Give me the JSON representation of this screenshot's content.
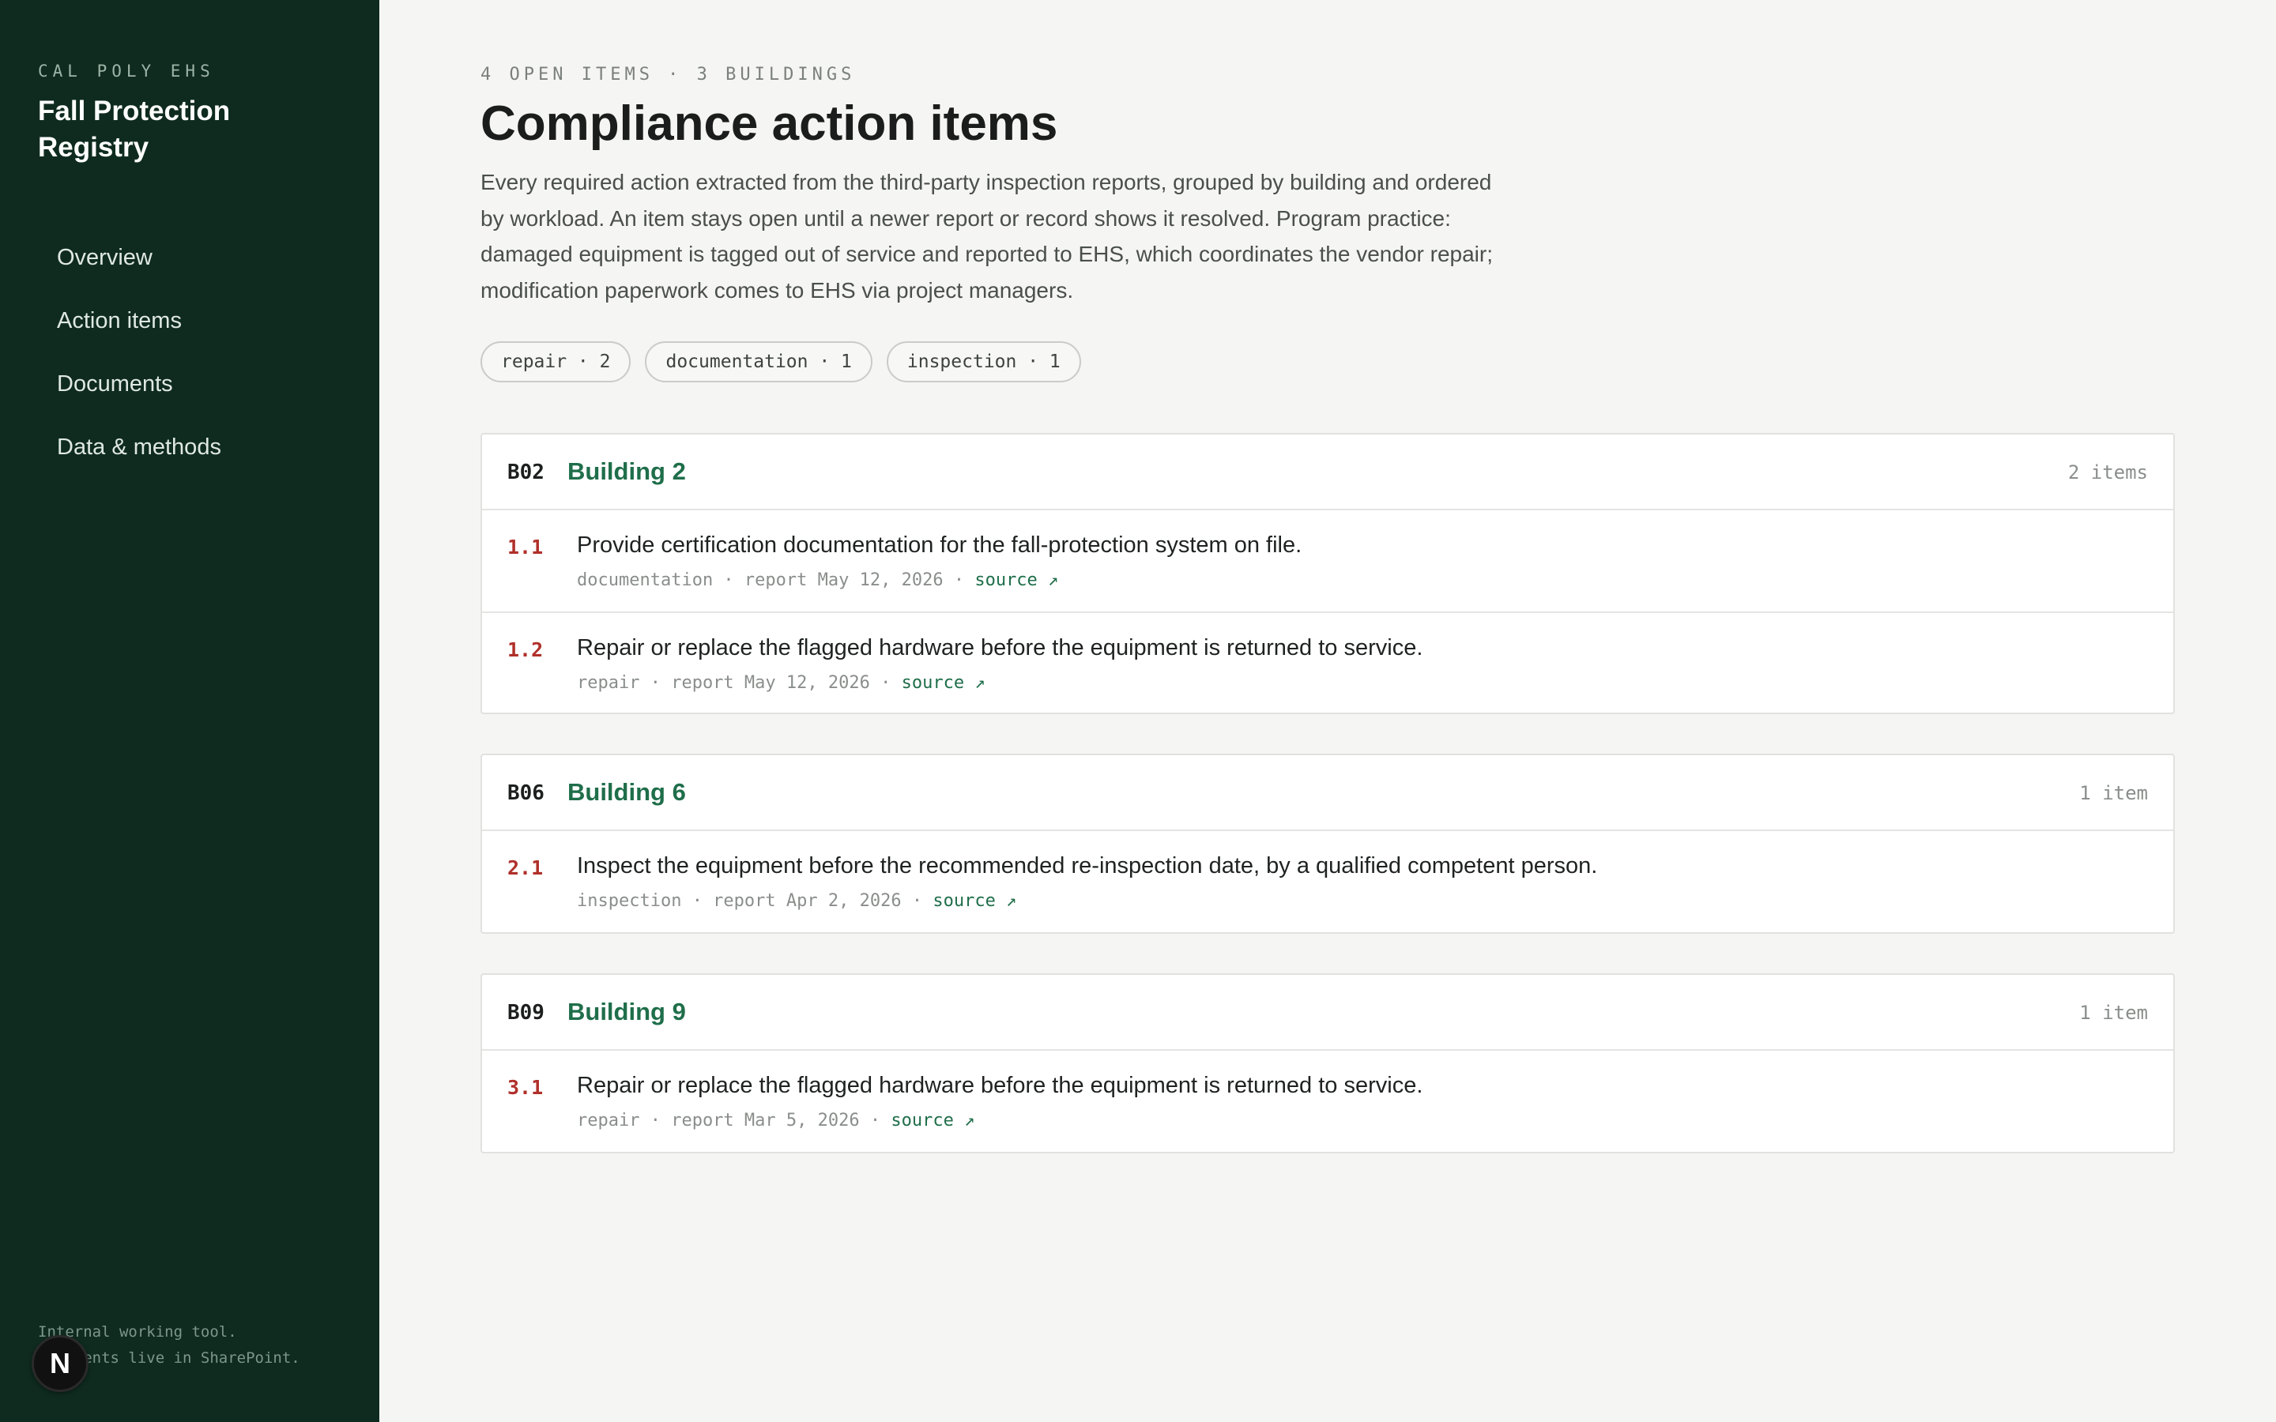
{
  "sidebar": {
    "org": "CAL POLY EHS",
    "title": "Fall Protection Registry",
    "nav": [
      "Overview",
      "Action items",
      "Documents",
      "Data & methods"
    ],
    "footer_line1": "Internal working tool.",
    "footer_line2": "Documents live in SharePoint.",
    "badge": "N"
  },
  "main": {
    "eyebrow": "4 OPEN ITEMS · 3 BUILDINGS",
    "title": "Compliance action items",
    "intro": "Every required action extracted from the third-party inspection reports, grouped by building and ordered by workload. An item stays open until a newer report or record shows it resolved. Program practice: damaged equipment is tagged out of service and reported to EHS, which coordinates the vendor repair; modification paperwork comes to EHS via project managers.",
    "chips": [
      "repair · 2",
      "documentation · 1",
      "inspection · 1"
    ],
    "buildings": [
      {
        "code": "B02",
        "name": "Building 2",
        "count": "2 items",
        "items": [
          {
            "num": "1.1",
            "text": "Provide certification documentation for the fall-protection system on file.",
            "meta": "documentation · report May 12, 2026 · ",
            "source": "source ↗"
          },
          {
            "num": "1.2",
            "text": "Repair or replace the flagged hardware before the equipment is returned to service.",
            "meta": "repair · report May 12, 2026 · ",
            "source": "source ↗"
          }
        ]
      },
      {
        "code": "B06",
        "name": "Building 6",
        "count": "1 item",
        "items": [
          {
            "num": "2.1",
            "text": "Inspect the equipment before the recommended re-inspection date, by a qualified competent person.",
            "meta": "inspection · report Apr 2, 2026 · ",
            "source": "source ↗"
          }
        ]
      },
      {
        "code": "B09",
        "name": "Building 9",
        "count": "1 item",
        "items": [
          {
            "num": "3.1",
            "text": "Repair or replace the flagged hardware before the equipment is returned to service.",
            "meta": "repair · report Mar 5, 2026 · ",
            "source": "source ↗"
          }
        ]
      }
    ]
  },
  "colors": {
    "sidebar_bg": "#0f2b20",
    "accent_green": "#1f6e4a",
    "item_number_red": "#b0302a",
    "page_bg": "#f5f5f3"
  }
}
